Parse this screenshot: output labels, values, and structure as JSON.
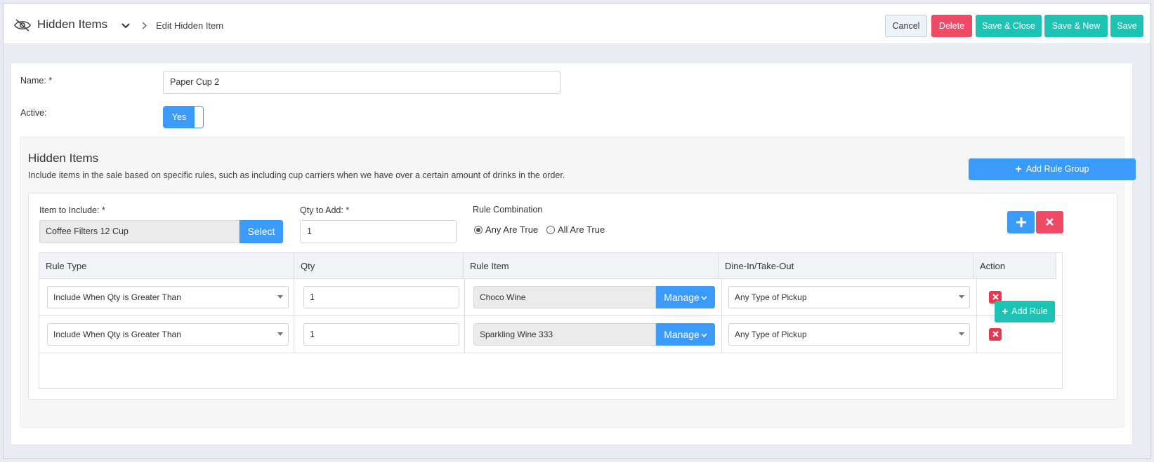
{
  "header": {
    "module_title": "Hidden Items",
    "breadcrumb_current": "Edit Hidden Item",
    "buttons": {
      "cancel": "Cancel",
      "delete": "Delete",
      "save_close": "Save & Close",
      "save_new": "Save & New",
      "save": "Save"
    }
  },
  "form": {
    "name_label": "Name: *",
    "name_value": "Paper Cup 2",
    "active_label": "Active:",
    "active_value": "Yes"
  },
  "section": {
    "title": "Hidden Items",
    "description": "Include items in the sale based on specific rules, such as including cup carriers when we have over a certain amount of drinks in the order.",
    "add_group_label": "Add Rule Group"
  },
  "group": {
    "item_label": "Item to Include: *",
    "item_value": "Coffee Filters 12 Cup",
    "select_label": "Select",
    "qty_label": "Qty to Add: *",
    "qty_value": "1",
    "combo_label": "Rule Combination",
    "combo_options": [
      "Any Are True",
      "All Are True"
    ],
    "combo_selected": "Any Are True",
    "add_rule_label": "Add Rule"
  },
  "table": {
    "headers": [
      "Rule Type",
      "Qty",
      "Rule Item",
      "Dine-In/Take-Out",
      "Action"
    ],
    "rows": [
      {
        "rule_type": "Include When Qty is Greater Than",
        "qty": "1",
        "rule_item": "Choco Wine",
        "manage": "Manage",
        "dine": "Any Type of Pickup"
      },
      {
        "rule_type": "Include When Qty is Greater Than",
        "qty": "1",
        "rule_item": "Sparkling Wine 333",
        "manage": "Manage",
        "dine": "Any Type of Pickup"
      }
    ]
  },
  "colors": {
    "primary": "#3a9bfa",
    "teal": "#1cc3b3",
    "danger": "#f04a66"
  }
}
